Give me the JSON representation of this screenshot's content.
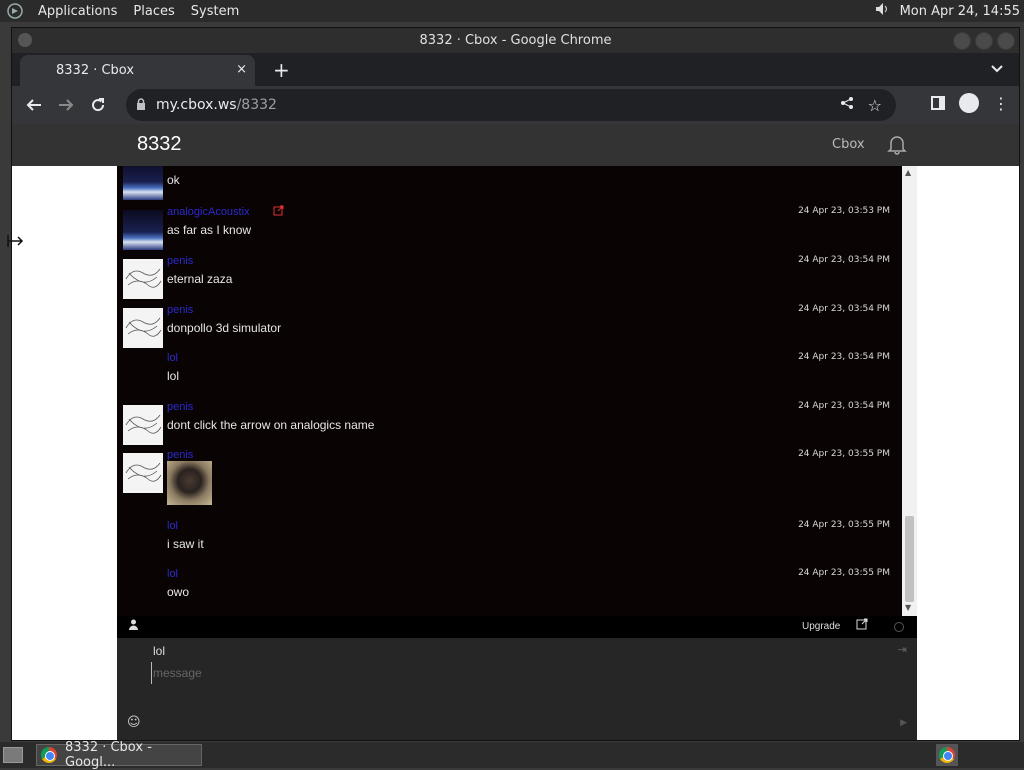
{
  "panel": {
    "menus": [
      "Applications",
      "Places",
      "System"
    ],
    "clock": "Mon Apr 24, 14:55"
  },
  "window": {
    "title": "8332 · Cbox - Google Chrome"
  },
  "tab": {
    "title": "8332 · Cbox",
    "close": "×",
    "new": "+"
  },
  "address": {
    "host": "my.cbox.ws",
    "path": "/8332"
  },
  "cbox": {
    "title": "8332",
    "brand": "Cbox",
    "messages": [
      {
        "name": "",
        "text": "ok",
        "time": "",
        "avatar": "space"
      },
      {
        "name": "analogicAcoustix",
        "text": "as far as I know",
        "time": "24 Apr 23, 03:53 PM",
        "avatar": "space"
      },
      {
        "name": "penis",
        "text": "eternal zaza",
        "time": "24 Apr 23, 03:54 PM",
        "avatar": "sketch"
      },
      {
        "name": "penis",
        "text": "donpollo 3d simulator",
        "time": "24 Apr 23, 03:54 PM",
        "avatar": "sketch"
      },
      {
        "name": "lol",
        "text": "lol",
        "time": "24 Apr 23, 03:54 PM",
        "avatar": "none"
      },
      {
        "name": "penis",
        "text": "dont click the arrow on analogics name",
        "time": "24 Apr 23, 03:54 PM",
        "avatar": "sketch"
      },
      {
        "name": "penis",
        "text": "",
        "time": "24 Apr 23, 03:55 PM",
        "avatar": "sketch"
      },
      {
        "name": "lol",
        "text": "i saw it",
        "time": "24 Apr 23, 03:55 PM",
        "avatar": "none"
      },
      {
        "name": "lol",
        "text": "owo",
        "time": "24 Apr 23, 03:55 PM",
        "avatar": "none"
      }
    ],
    "upgrade": "Upgrade",
    "nickname": "lol",
    "message_placeholder": "message"
  },
  "taskbar": {
    "task_label": "8332 · Cbox - Googl..."
  }
}
